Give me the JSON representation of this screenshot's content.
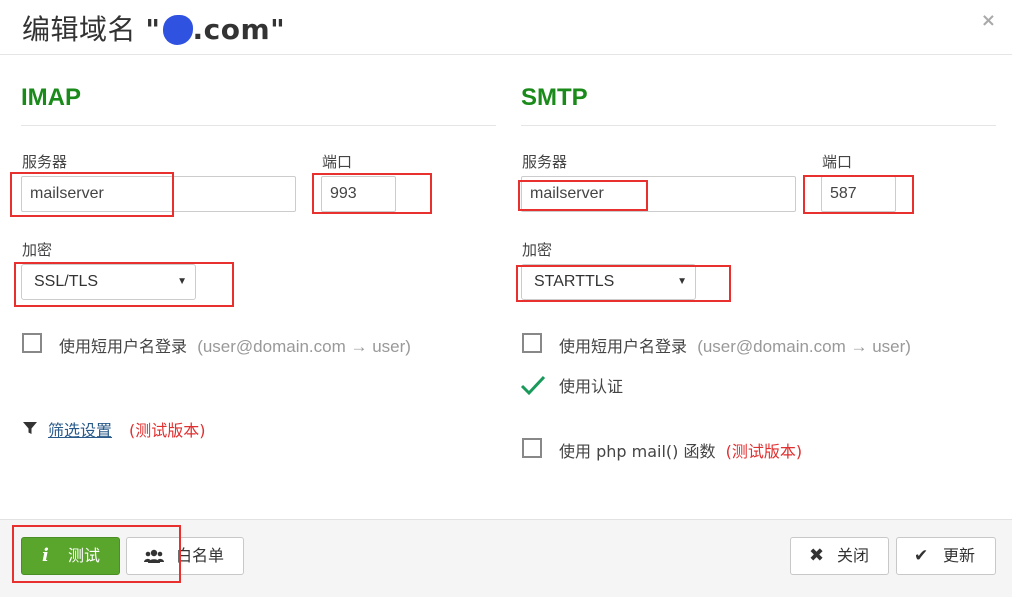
{
  "dialog": {
    "title_prefix": "编辑域名 ",
    "title_quote_open": "\"",
    "title_domain": ".com",
    "title_quote_close": "\"",
    "close": "×"
  },
  "imap": {
    "heading": "IMAP",
    "server_label": "服务器",
    "server_value": "mailserver",
    "port_label": "端口",
    "port_value": "993",
    "encryption_label": "加密",
    "encryption_value": "SSL/TLS",
    "short_username_label": "使用短用户名登录",
    "short_username_hint": "(user@domain.com → user)",
    "filter_link": "筛选设置",
    "filter_beta": "(测试版本)"
  },
  "smtp": {
    "heading": "SMTP",
    "server_label": "服务器",
    "server_value": "mailserver",
    "port_label": "端口",
    "port_value": "587",
    "encryption_label": "加密",
    "encryption_value": "STARTTLS",
    "short_username_label": "使用短用户名登录",
    "short_username_hint": "(user@domain.com → user)",
    "auth_label": "使用认证",
    "phpmail_label": "使用 php mail() 函数",
    "phpmail_beta": "(测试版本)"
  },
  "footer": {
    "test_label": "测试",
    "whitelist_label": "白名单",
    "close_label": "关闭",
    "update_label": "更新"
  },
  "colors": {
    "heading_green": "#1a8a1a",
    "annotation_red": "#e8302f",
    "test_button_green": "#5aa52c",
    "check_green": "#1a9a5a"
  }
}
